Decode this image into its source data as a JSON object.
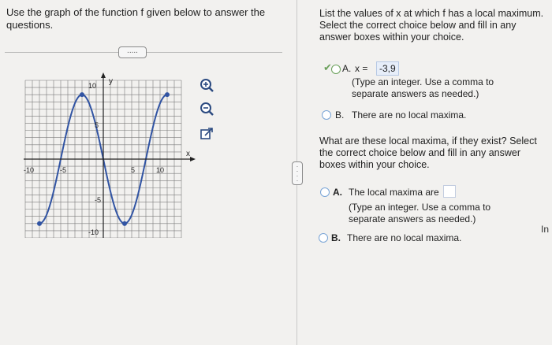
{
  "left": {
    "instruction": "Use the graph of the function f given below to answer the questions.",
    "dots_button": "....."
  },
  "graph": {
    "y_label": "y",
    "x_label": "x",
    "tick_labels_x": [
      "-10",
      "-5",
      "5",
      "10"
    ],
    "tick_labels_y": [
      "10",
      "5",
      "-5",
      "-10"
    ]
  },
  "tools": {
    "zoom_in": "zoom-in-icon",
    "zoom_out": "zoom-out-icon",
    "open": "external-link-icon"
  },
  "q1": {
    "prompt": "List the values of x at which f has a local maximum. Select the correct choice below and fill in any answer boxes within your choice.",
    "optionA_letter": "A.",
    "optionA_prefix": "x =",
    "optionA_value": "-3,9",
    "optionA_hint": "(Type an integer. Use a comma to separate answers as needed.)",
    "optionB_letter": "B.",
    "optionB_text": "There are no local maxima."
  },
  "q2": {
    "prompt": "What are these local maxima, if they exist? Select the correct choice below and fill in any answer boxes within your choice.",
    "optionA_letter": "A.",
    "optionA_text": "The local maxima are",
    "optionA_hint": "(Type an integer. Use a comma to separate answers as needed.)",
    "optionB_letter": "B.",
    "optionB_text": "There are no local maxima."
  },
  "edge_text": "In",
  "colors": {
    "accent": "#2f5fb0",
    "curve": "#3154a3",
    "grid": "#7b7b7b",
    "check": "#6aa05a"
  }
}
